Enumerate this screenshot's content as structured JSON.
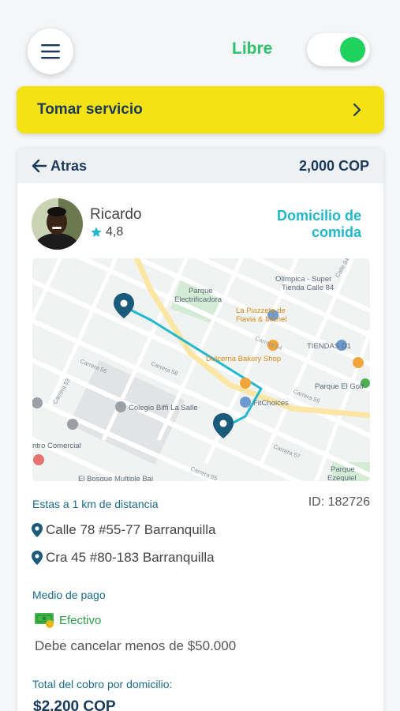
{
  "header": {
    "status_label": "Libre",
    "toggle_on": true
  },
  "take_service": {
    "label": "Tomar servicio"
  },
  "card": {
    "back_label": "Atras",
    "price": "2,000 COP",
    "driver": {
      "name": "Ricardo",
      "rating": "4,8"
    },
    "service_type": "Domicilio de comida",
    "map": {
      "labels": {
        "olimpica": "Olímpica - Super",
        "olimpica2": "Tienda Calle 84",
        "parque_elec": "Parque",
        "parque_elec2": "Electrificadora",
        "piazzetta": "La Piazzeta de",
        "piazzetta2": "Flavia & Michel",
        "tiendas_d1": "TIENDAS D1",
        "dulcerna": "Dulcerna Bakery Shop",
        "parque_golf": "Parque El Golf",
        "fitchoices": "FitChoices",
        "colegio": "Colegio Biffi La Salle",
        "centro": "ntro Comercial",
        "parque_ezequiel": "Parque",
        "parque_ezequiel2": "Ezequiel",
        "el_bosque": "El Bosque Multiple Bai",
        "carrera_53": "Carrera 53",
        "carrera_64": "Carrera 64",
        "carrera_57": "Carrera 57",
        "calle_84": "Calle 84",
        "carrera_58": "Carrera 58",
        "carrera_56": "Carrera 56",
        "carrera_55": "Carrera 55",
        "carrera_59": "Carrera 59"
      }
    },
    "distance": "Estas a 1 km de distancia",
    "order_id": "ID: 182726",
    "pickup_address": "Calle 78 #55-77 Barranquilla",
    "dropoff_address": "Cra 45 #80-183 Barranquilla",
    "payment_label": "Medio de pago",
    "payment_method": "Efectivo",
    "payment_note": "Debe cancelar menos de $50.000",
    "total_label": "Total del cobro por domicilio:",
    "total_value": "$2.200 COP"
  },
  "colors": {
    "accent_yellow": "#f5e214",
    "status_green": "#2dc26b",
    "teal": "#20b8c8",
    "navy": "#1a3a5c",
    "route": "#22b8cf",
    "pin": "#1a5a7a"
  }
}
